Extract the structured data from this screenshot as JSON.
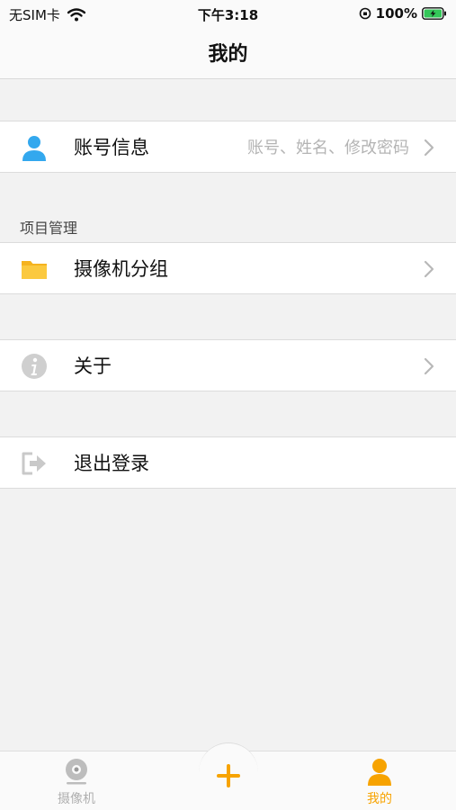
{
  "status_bar": {
    "carrier": "无SIM卡",
    "time": "下午3:18",
    "battery": "100%"
  },
  "nav": {
    "title": "我的"
  },
  "account_row": {
    "label": "账号信息",
    "hint": "账号、姓名、修改密码"
  },
  "project_section": {
    "label": "项目管理"
  },
  "camera_group_row": {
    "label": "摄像机分组"
  },
  "about_row": {
    "label": "关于"
  },
  "logout_row": {
    "label": "退出登录"
  },
  "tabbar": {
    "tabs": [
      {
        "label": "摄像机",
        "active": false
      },
      {
        "label": "我的",
        "active": true
      }
    ]
  },
  "colors": {
    "accent": "#f7a300",
    "account_icon": "#33a8ee",
    "folder_icon": "#f9c23c",
    "inactive": "#b5b5b5",
    "background": "#f2f2f2"
  }
}
